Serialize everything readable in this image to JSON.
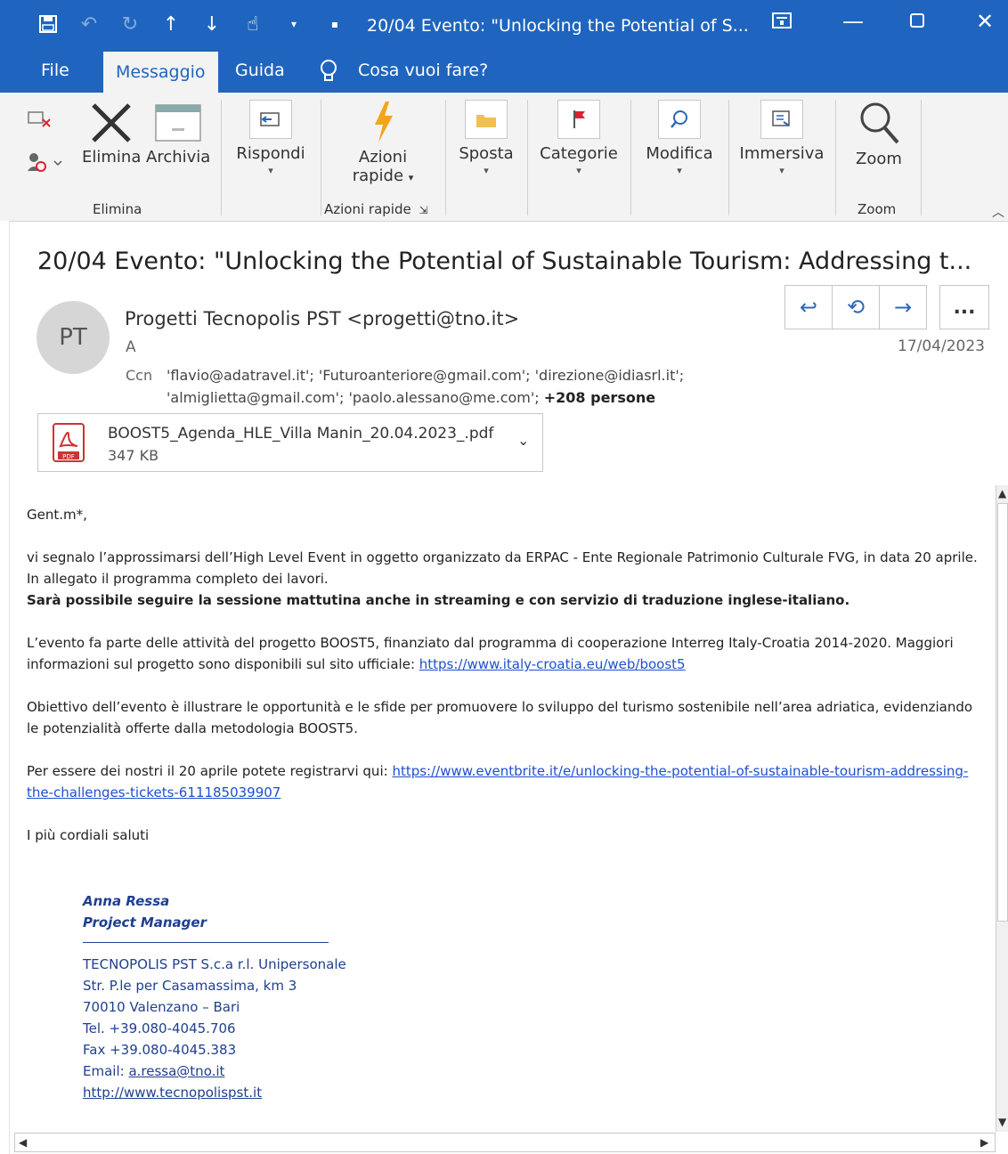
{
  "window": {
    "title": "20/04 Evento: \"Unlocking the Potential of S...",
    "ribbon_display_icon": "ribbon-display-icon",
    "minimize_icon": "minimize-icon",
    "maximize_icon": "maximize-icon",
    "close_icon": "close-icon"
  },
  "quick_access": [
    "save-icon",
    "undo-icon",
    "redo-icon",
    "up-arrow-icon",
    "down-arrow-icon",
    "touch-mode-icon"
  ],
  "menu": {
    "tabs": [
      "File",
      "Messaggio",
      "Guida"
    ],
    "active_tab": "Messaggio",
    "tell_me": "Cosa vuoi fare?"
  },
  "ribbon": {
    "elimina_label": "Elimina",
    "archivia_label": "Archivia",
    "rispondi_label": "Rispondi",
    "azioni_label_1": "Azioni",
    "azioni_label_2": "rapide",
    "sposta_label": "Sposta",
    "categorie_label": "Categorie",
    "modifica_label": "Modifica",
    "immersiva_label": "Immersiva",
    "zoom_label": "Zoom",
    "groups": {
      "elimina": "Elimina",
      "azioni_rapide": "Azioni rapide",
      "zoom": "Zoom"
    }
  },
  "message": {
    "subject": "20/04 Evento: \"Unlocking the Potential of Sustainable Tourism: Addressing t...",
    "avatar_initials": "PT",
    "sender": "Progetti Tecnopolis PST <progetti@tno.it>",
    "to_label": "A",
    "cc_label": "Ccn",
    "cc_line1": "'flavio@adatravel.it'; 'Futuroanteriore@gmail.com'; 'direzione@idiasrl.it';",
    "cc_line2": "'almiglietta@gmail.com'; 'paolo.alessano@me.com';",
    "cc_more": "+208 persone",
    "date": "17/04/2023",
    "more_actions": "...",
    "attachment": {
      "name": "BOOST5_Agenda_HLE_Villa Manin_20.04.2023_.pdf",
      "size": "347 KB",
      "pdf_badge": "PDF"
    }
  },
  "body": {
    "greeting": "Gent.m*,",
    "p1_a": "vi segnalo l’approssimarsi dell’High Level Event in oggetto organizzato da ERPAC - Ente Regionale Patrimonio Culturale FVG, in data 20 aprile. In allegato il programma completo dei lavori.",
    "p1_bold": "Sarà possibile seguire la sessione mattutina anche in streaming e con servizio di traduzione inglese-italiano.",
    "p2_text": "L’evento fa parte delle attività del progetto BOOST5, finanziato dal programma di cooperazione Interreg Italy-Croatia 2014-2020. Maggiori informazioni sul progetto sono disponibili sul sito ufficiale: ",
    "p2_link": "https://www.italy-croatia.eu/web/boost5",
    "p3": "Obiettivo dell’evento è illustrare le opportunità e le sfide per promuovere lo sviluppo del turismo sostenibile nell’area adriatica, evidenziando le potenzialità offerte dalla metodologia BOOST5.",
    "p4_text": "Per essere dei nostri il 20 aprile potete registrarvi qui: ",
    "p4_link": "https://www.eventbrite.it/e/unlocking-the-potential-of-sustainable-tourism-addressing-the-challenges-tickets-611185039907",
    "closing": "I più cordiali saluti"
  },
  "signature": {
    "name": "Anna Ressa",
    "role": "Project Manager",
    "company": "TECNOPOLIS PST S.c.a r.l. Unipersonale",
    "address1": "Str. P.le per Casamassima, km 3",
    "address2": "70010 Valenzano – Bari",
    "tel": "Tel. +39.080-4045.706",
    "fax": "Fax +39.080-4045.383",
    "email_label": "Email: ",
    "email": "a.ressa@tno.it",
    "website": "http://www.tecnopolispst.it"
  },
  "colors": {
    "accent": "#1f65bf",
    "link": "#1f4fcf",
    "signature": "#1f3f8f"
  }
}
